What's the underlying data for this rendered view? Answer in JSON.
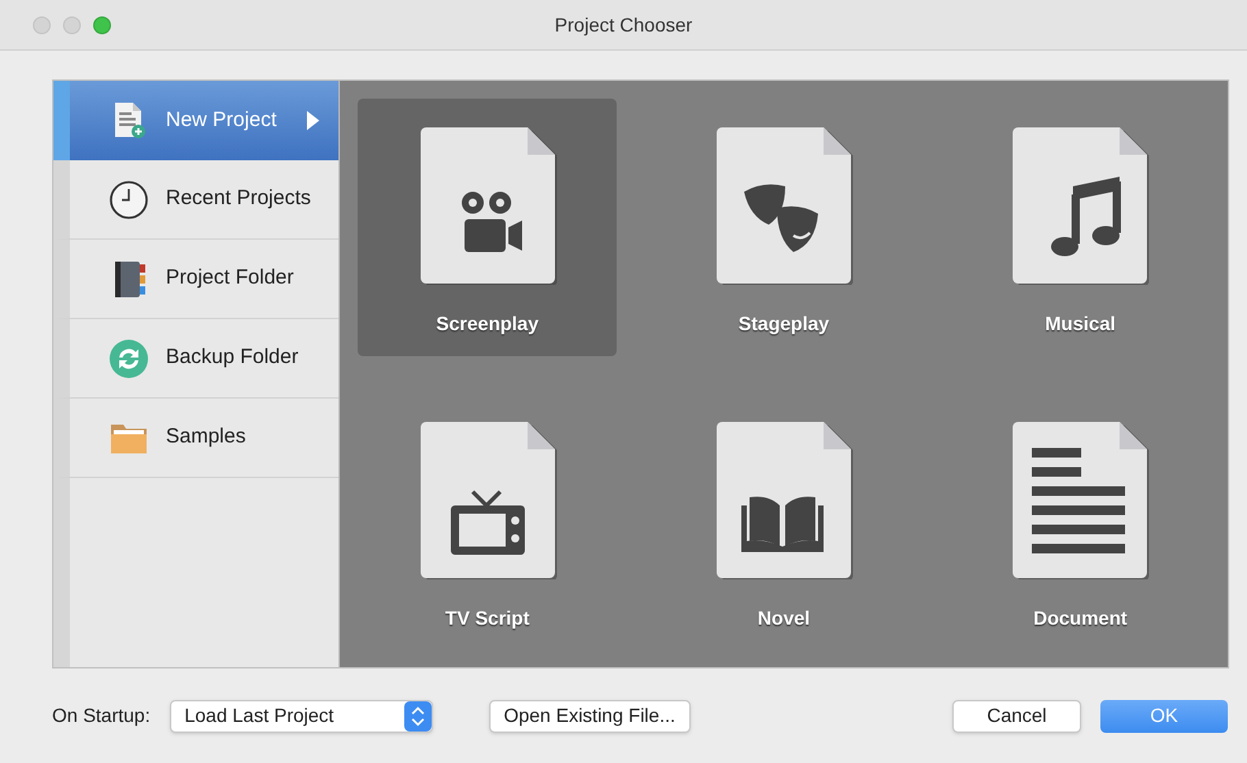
{
  "window": {
    "title": "Project Chooser"
  },
  "sidebar": {
    "items": [
      {
        "label": "New Project",
        "kind": "new",
        "selected": true
      },
      {
        "label": "Recent Projects",
        "kind": "recent",
        "selected": false
      },
      {
        "label": "Project Folder",
        "kind": "folder",
        "selected": false
      },
      {
        "label": "Backup Folder",
        "kind": "backup",
        "selected": false
      },
      {
        "label": "Samples",
        "kind": "samples",
        "selected": false
      }
    ]
  },
  "templates": [
    {
      "label": "Screenplay",
      "kind": "camera",
      "selected": true
    },
    {
      "label": "Stageplay",
      "kind": "masks",
      "selected": false
    },
    {
      "label": "Musical",
      "kind": "music",
      "selected": false
    },
    {
      "label": "TV Script",
      "kind": "tv",
      "selected": false
    },
    {
      "label": "Novel",
      "kind": "book",
      "selected": false
    },
    {
      "label": "Document",
      "kind": "lines",
      "selected": false
    }
  ],
  "footer": {
    "startup_label": "On Startup:",
    "startup_value": "Load Last Project",
    "open_button": "Open Existing File...",
    "cancel_button": "Cancel",
    "ok_button": "OK"
  }
}
